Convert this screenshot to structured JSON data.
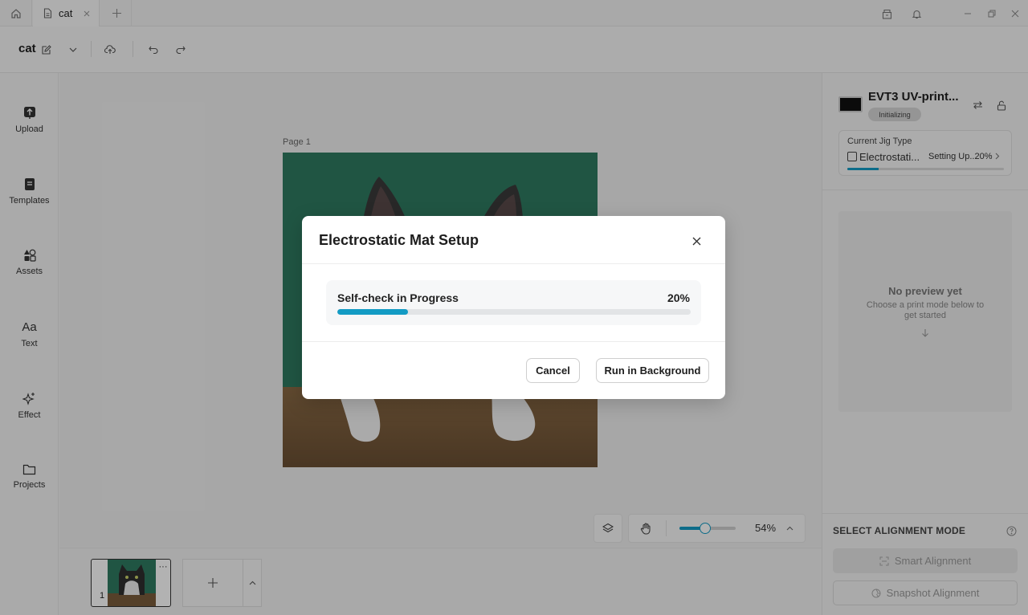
{
  "titlebar": {
    "tab_label": "cat",
    "colors": {
      "bg": "#f3f3f3"
    }
  },
  "toolbar": {
    "doc_title": "cat"
  },
  "sidebar": {
    "items": [
      {
        "label": "Upload",
        "icon": "upload-icon"
      },
      {
        "label": "Templates",
        "icon": "templates-icon"
      },
      {
        "label": "Assets",
        "icon": "assets-icon"
      },
      {
        "label": "Text",
        "icon": "text-icon",
        "glyph": "Aa"
      },
      {
        "label": "Effect",
        "icon": "sparkle-icon"
      },
      {
        "label": "Projects",
        "icon": "folder-icon"
      }
    ]
  },
  "canvas": {
    "page_label": "Page 1"
  },
  "zoom": {
    "level": "54%",
    "slider_fraction": 0.45
  },
  "thumbnails": {
    "items": [
      {
        "number": "1"
      }
    ]
  },
  "device": {
    "name": "EVT3 UV-print...",
    "status": "Initializing",
    "jig_title": "Current Jig Type",
    "jig_name": "Electrostati...",
    "jig_status": "Setting Up..20%",
    "jig_progress": 0.2
  },
  "preview": {
    "title": "No preview yet",
    "subtitle": "Choose a print mode below to get started"
  },
  "alignment": {
    "title": "SELECT ALIGNMENT MODE",
    "smart_label": "Smart Alignment",
    "snapshot_label": "Snapshot Alignment"
  },
  "modal": {
    "title": "Electrostatic Mat Setup",
    "progress_label": "Self-check in Progress",
    "progress_value": "20%",
    "progress_fraction": 0.2,
    "cancel_label": "Cancel",
    "background_label": "Run in Background",
    "accent_color": "#139bc4"
  }
}
